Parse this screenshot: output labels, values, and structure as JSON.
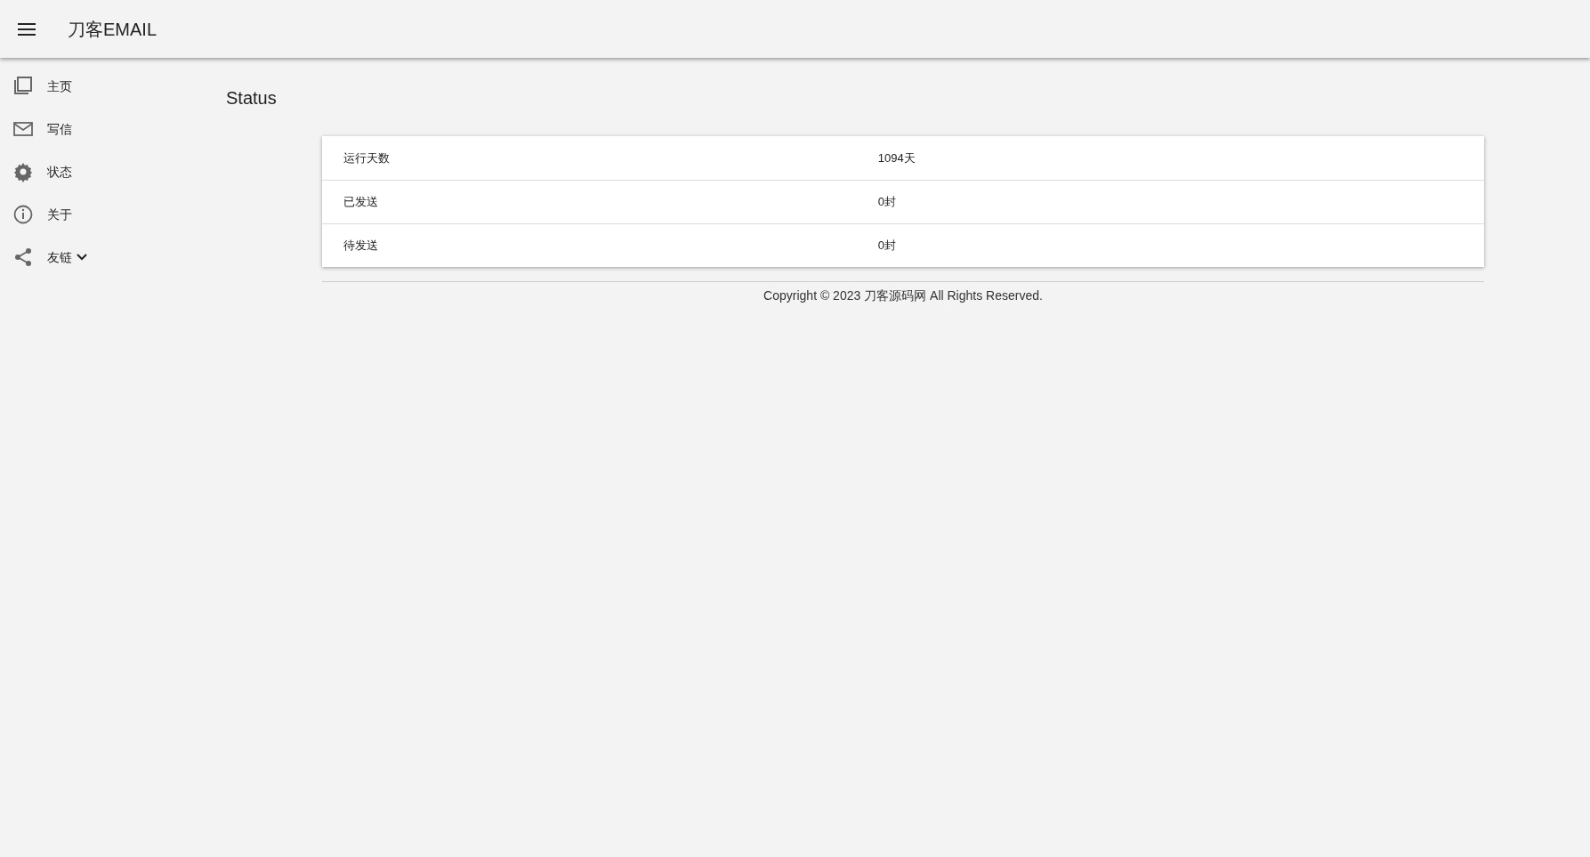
{
  "app_bar": {
    "title": "刀客EMAIL"
  },
  "sidebar": {
    "items": [
      {
        "label": "主页",
        "kind": "link"
      },
      {
        "label": "写信",
        "kind": "link"
      },
      {
        "label": "状态",
        "kind": "link"
      },
      {
        "label": "关于",
        "kind": "link"
      },
      {
        "label": "友链",
        "kind": "dropdown"
      }
    ]
  },
  "page_title": "Status",
  "table": {
    "rows": [
      {
        "label": "运行天数",
        "value": "1094天"
      },
      {
        "label": "已发送",
        "value": "0封"
      },
      {
        "label": "待发送",
        "value": "0封"
      }
    ]
  },
  "footer": "Copyright © 2023 刀客源码网 All Rights Reserved."
}
